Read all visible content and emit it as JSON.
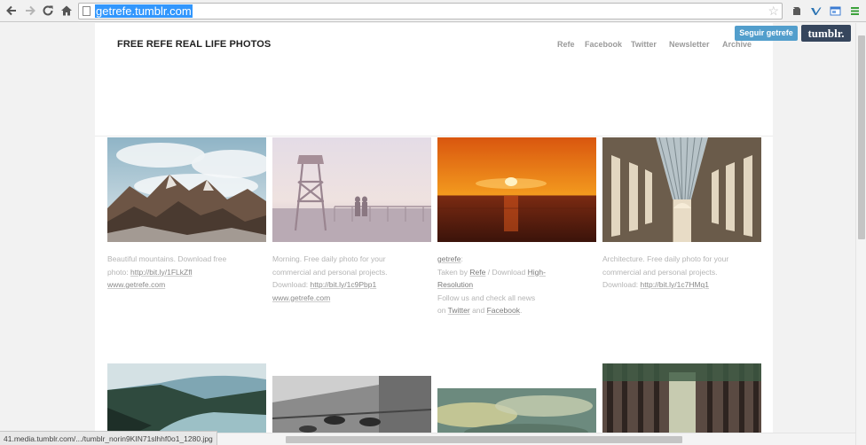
{
  "browser": {
    "url": "getrefe.tumblr.com",
    "status_url": "41.media.tumblr.com/.../tumblr_norin9KIN71slhhf0o1_1280.jpg"
  },
  "tumblr": {
    "follow_label": "Seguir getrefe",
    "logo": "tumblr."
  },
  "blog": {
    "title": "FREE REFE REAL LIFE PHOTOS",
    "nav": [
      "Refe",
      "Facebook",
      "Twitter",
      "Newsletter",
      "Archive"
    ]
  },
  "posts": [
    {
      "image": "mountains",
      "line1": "Beautiful mountains. Download free",
      "line2_prefix": "photo: ",
      "line2_link": "http://bit.ly/1FLkZfl",
      "line3_link": "www.getrefe.com"
    },
    {
      "image": "lifeguard-tower",
      "line1": "Morning. Free daily photo for your",
      "line2": "commercial and personal projects.",
      "line3_prefix": "Download: ",
      "line3_link": "http://bit.ly/1c9Pbp1",
      "line4_link": "www.getrefe.com"
    },
    {
      "image": "sunset",
      "author_link": "getrefe",
      "author_suffix": ":",
      "taken_prefix": "Taken by ",
      "taken_link": "Refe",
      "taken_mid": " / Download ",
      "taken_link2a": "High-",
      "taken_link2b": "Resolution",
      "follow_line": "Follow us and check all news",
      "on_prefix": "on ",
      "on_link1": "Twitter",
      "on_mid": " and ",
      "on_link2": "Facebook",
      "on_suffix": "."
    },
    {
      "image": "arcade",
      "line1": "Architecture. Free daily photo for your",
      "line2": "commercial and personal projects.",
      "line3_prefix": "Download: ",
      "line3_link": "http://bit.ly/1c7HMq1"
    }
  ],
  "colors": {
    "url_highlight": "#3297fd",
    "follow_button": "#529ecc",
    "tumblr_logo_bg": "#36465d",
    "caption": "#b4b4b4",
    "nav": "#9a9a9a"
  }
}
